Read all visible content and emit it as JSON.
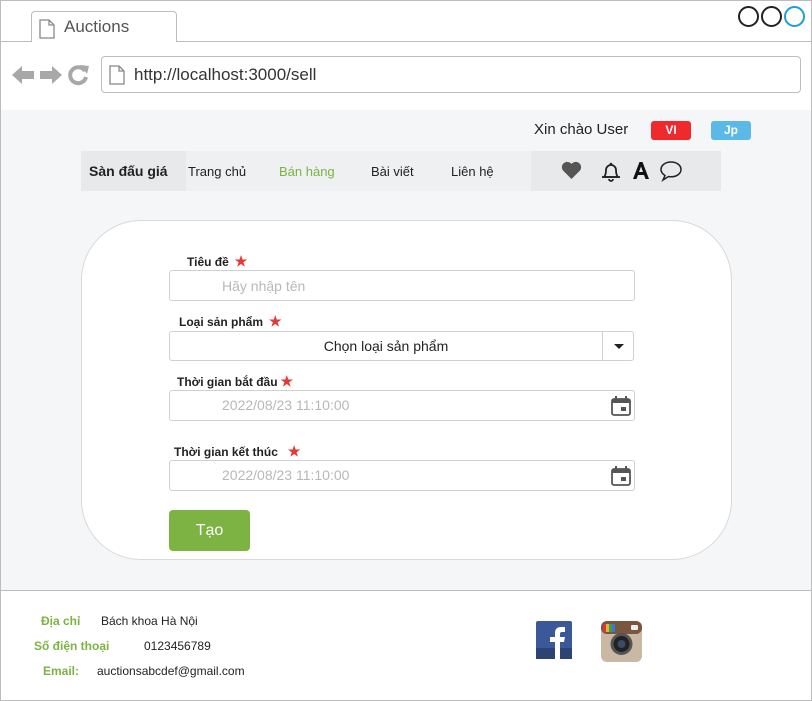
{
  "browser": {
    "tab_title": "Auctions",
    "url": "http://localhost:3000/sell"
  },
  "header": {
    "greeting": "Xin chào User",
    "lang_vi": "VI",
    "lang_jp": "Jp"
  },
  "nav": {
    "brand": "Sàn đấu giá",
    "links": [
      {
        "label": "Trang chủ"
      },
      {
        "label": "Bán hàng"
      },
      {
        "label": "Bài viết"
      },
      {
        "label": "Liên hệ"
      }
    ],
    "icons": [
      "heart-icon",
      "bell-icon",
      "font-icon",
      "chat-icon"
    ]
  },
  "form": {
    "title_label": "Tiêu đề",
    "title_placeholder": "Hãy nhập tên",
    "category_label": "Loại sản phẩm",
    "category_value": "Chọn loại sản phẩm",
    "start_label": "Thời gian bắt đầu",
    "start_value": "2022/08/23 11:10:00",
    "end_label": "Thời gian kết thúc",
    "end_value": "2022/08/23 11:10:00",
    "required_mark": "★",
    "submit_label": "Tạo"
  },
  "footer": {
    "address_label": "Địa chỉ",
    "address_value": "Bách khoa Hà Nội",
    "phone_label": "Số điện thoại",
    "phone_value": "0123456789",
    "email_label": "Email:",
    "email_value": "auctionsabcdef@gmail.com"
  },
  "colors": {
    "accent_green": "#7cb342",
    "required_red": "#e53935",
    "vi_red": "#f0292c",
    "jp_blue": "#5ab9e6"
  }
}
